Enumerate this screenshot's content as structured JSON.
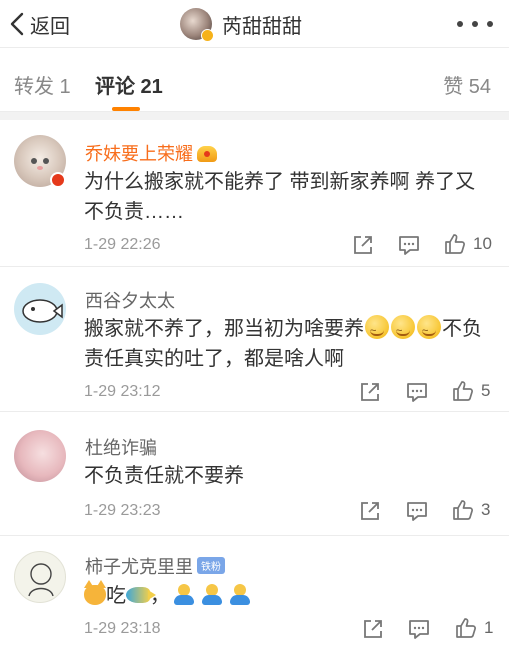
{
  "header": {
    "back_label": "返回",
    "title": "芮甜甜甜"
  },
  "tabs": {
    "repost": "转发 1",
    "comment": "评论 21",
    "like": "赞 54",
    "accent": "#ff8200"
  },
  "colors": {
    "name_orange": "#f86d1b",
    "name_gray": "#666666",
    "meta_gray": "#9a9a9a"
  },
  "comments": [
    {
      "name": "乔妹要上荣耀",
      "badge": "crown-badge",
      "text": "为什么搬家就不能养了 带到新家养啊 养了又不负责……",
      "time": "1-29 22:26",
      "likes": "10"
    },
    {
      "name": "西谷夕太太",
      "text_a": "搬家就不养了，那当初为啥要养",
      "emoji": "dizzy-face-icon",
      "text_b": "不负责任真实的吐了，都是啥人啊",
      "time": "1-29 23:12",
      "likes": "5"
    },
    {
      "name": "杜绝诈骗",
      "text": "不负责任就不要养",
      "time": "1-29 23:23",
      "likes": "3"
    },
    {
      "name": "柿子尤克里里",
      "badge": "铁粉",
      "text_a": "吃",
      "text_b": "，",
      "emojis": [
        "cat-face-icon",
        "fish-icon",
        "gift-person-icon"
      ],
      "time": "1-29 23:18",
      "likes": "1"
    }
  ]
}
